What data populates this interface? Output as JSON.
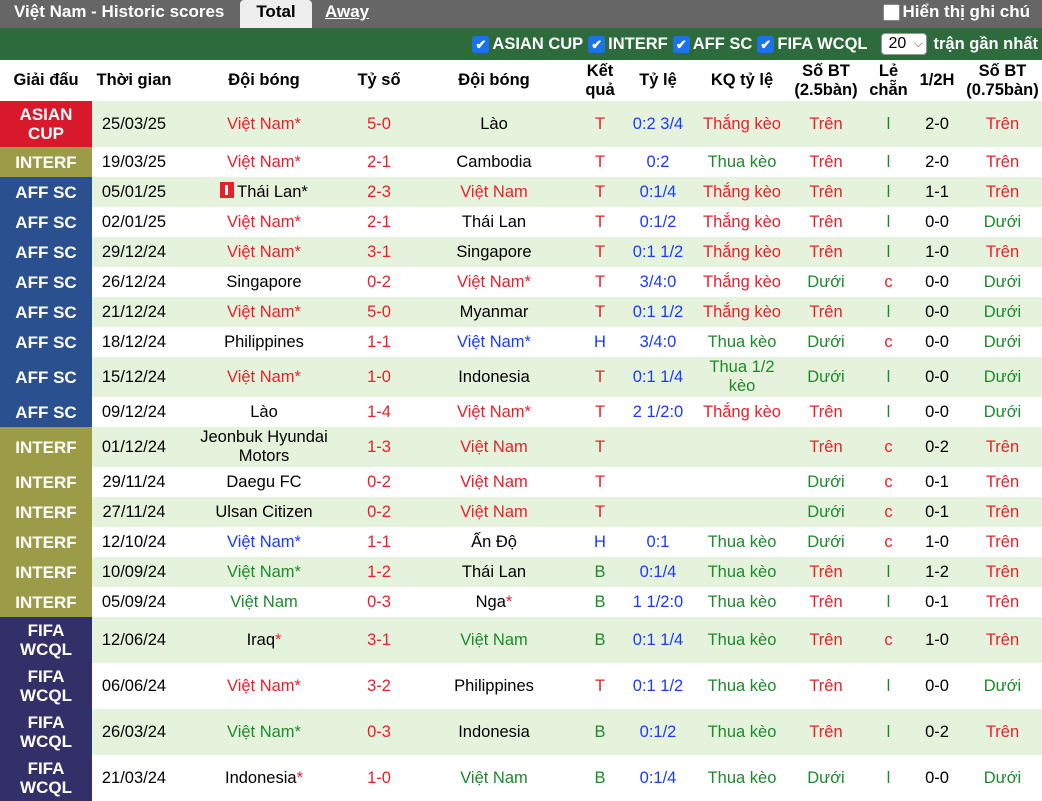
{
  "header": {
    "title": "Việt Nam - Historic scores",
    "tab_total": "Total",
    "tab_away": "Away",
    "show_label": "Hiển thị ghi chú"
  },
  "filters": {
    "items": [
      "ASIAN CUP",
      "INTERF",
      "AFF SC",
      "FIFA WCQL"
    ],
    "count_value": "20",
    "count_suffix": "trận gần nhất"
  },
  "colors": {
    "ASIAN CUP": "#d7192b",
    "INTERF": "#9c9c48",
    "AFF SC": "#2a5090",
    "FIFA WCQL": "#322f69"
  },
  "table": {
    "headers": [
      "Giải đấu",
      "Thời gian",
      "Đội bóng",
      "Tỷ số",
      "Đội bóng",
      "Kết quả",
      "Tỷ lệ",
      "KQ tỷ lệ",
      "Số BT (2.5bàn)",
      "Lẻ chẵn",
      "1/2H",
      "Số BT (0.75bàn)"
    ],
    "rows": [
      {
        "comp": "ASIAN CUP",
        "date": "25/03/25",
        "home": "Việt Nam*",
        "hc": "red",
        "score": "5-0",
        "away": "Lào",
        "ac": "black",
        "res": "T",
        "hdp": "0:2 3/4",
        "hr": "Thắng kèo",
        "hrc": "red",
        "ou": "Trên",
        "ouc": "red",
        "oe": "l",
        "oec": "green",
        "ht": "2-0",
        "ou2": "Trên",
        "ou2c": "red"
      },
      {
        "comp": "INTERF",
        "date": "19/03/25",
        "home": "Việt Nam*",
        "hc": "red",
        "score": "2-1",
        "away": "Cambodia",
        "ac": "black",
        "res": "T",
        "hdp": "0:2",
        "hr": "Thua kèo",
        "hrc": "green",
        "ou": "Trên",
        "ouc": "red",
        "oe": "l",
        "oec": "green",
        "ht": "2-0",
        "ou2": "Trên",
        "ou2c": "red"
      },
      {
        "comp": "AFF SC",
        "date": "05/01/25",
        "home": "Thái Lan*",
        "hc": "black",
        "flag": true,
        "score": "2-3",
        "away": "Việt Nam",
        "ac": "red",
        "res": "T",
        "hdp": "0:1/4",
        "hr": "Thắng kèo",
        "hrc": "red",
        "ou": "Trên",
        "ouc": "red",
        "oe": "l",
        "oec": "green",
        "ht": "1-1",
        "ou2": "Trên",
        "ou2c": "red"
      },
      {
        "comp": "AFF SC",
        "date": "02/01/25",
        "home": "Việt Nam*",
        "hc": "red",
        "score": "2-1",
        "away": "Thái Lan",
        "ac": "black",
        "res": "T",
        "hdp": "0:1/2",
        "hr": "Thắng kèo",
        "hrc": "red",
        "ou": "Trên",
        "ouc": "red",
        "oe": "l",
        "oec": "green",
        "ht": "0-0",
        "ou2": "Dưới",
        "ou2c": "green"
      },
      {
        "comp": "AFF SC",
        "date": "29/12/24",
        "home": "Việt Nam*",
        "hc": "red",
        "score": "3-1",
        "away": "Singapore",
        "ac": "black",
        "res": "T",
        "hdp": "0:1 1/2",
        "hr": "Thắng kèo",
        "hrc": "red",
        "ou": "Trên",
        "ouc": "red",
        "oe": "l",
        "oec": "green",
        "ht": "1-0",
        "ou2": "Trên",
        "ou2c": "red"
      },
      {
        "comp": "AFF SC",
        "date": "26/12/24",
        "home": "Singapore",
        "hc": "black",
        "score": "0-2",
        "away": "Việt Nam*",
        "ac": "red",
        "res": "T",
        "hdp": "3/4:0",
        "hr": "Thắng kèo",
        "hrc": "red",
        "ou": "Dưới",
        "ouc": "green",
        "oe": "c",
        "oec": "red",
        "ht": "0-0",
        "ou2": "Dưới",
        "ou2c": "green"
      },
      {
        "comp": "AFF SC",
        "date": "21/12/24",
        "home": "Việt Nam*",
        "hc": "red",
        "score": "5-0",
        "away": "Myanmar",
        "ac": "black",
        "res": "T",
        "hdp": "0:1 1/2",
        "hr": "Thắng kèo",
        "hrc": "red",
        "ou": "Trên",
        "ouc": "red",
        "oe": "l",
        "oec": "green",
        "ht": "0-0",
        "ou2": "Dưới",
        "ou2c": "green"
      },
      {
        "comp": "AFF SC",
        "date": "18/12/24",
        "home": "Philippines",
        "hc": "black",
        "score": "1-1",
        "away": "Việt Nam*",
        "ac": "blue",
        "res": "H",
        "hdp": "3/4:0",
        "hr": "Thua kèo",
        "hrc": "green",
        "ou": "Dưới",
        "ouc": "green",
        "oe": "c",
        "oec": "red",
        "ht": "0-0",
        "ou2": "Dưới",
        "ou2c": "green"
      },
      {
        "comp": "AFF SC",
        "date": "15/12/24",
        "home": "Việt Nam*",
        "hc": "red",
        "score": "1-0",
        "away": "Indonesia",
        "ac": "black",
        "res": "T",
        "hdp": "0:1 1/4",
        "hr": "Thua 1/2 kèo",
        "hrc": "green",
        "ou": "Dưới",
        "ouc": "green",
        "oe": "l",
        "oec": "green",
        "ht": "0-0",
        "ou2": "Dưới",
        "ou2c": "green"
      },
      {
        "comp": "AFF SC",
        "date": "09/12/24",
        "home": "Lào",
        "hc": "black",
        "score": "1-4",
        "away": "Việt Nam*",
        "ac": "red",
        "res": "T",
        "hdp": "2 1/2:0",
        "hr": "Thắng kèo",
        "hrc": "red",
        "ou": "Trên",
        "ouc": "red",
        "oe": "l",
        "oec": "green",
        "ht": "0-0",
        "ou2": "Dưới",
        "ou2c": "green"
      },
      {
        "comp": "INTERF",
        "date": "01/12/24",
        "home": "Jeonbuk Hyundai Motors",
        "hc": "black",
        "score": "1-3",
        "away": "Việt Nam",
        "ac": "red",
        "res": "T",
        "hdp": "",
        "hr": "",
        "hrc": "black",
        "ou": "Trên",
        "ouc": "red",
        "oe": "c",
        "oec": "red",
        "ht": "0-2",
        "ou2": "Trên",
        "ou2c": "red"
      },
      {
        "comp": "INTERF",
        "date": "29/11/24",
        "home": "Daegu FC",
        "hc": "black",
        "score": "0-2",
        "away": "Việt Nam",
        "ac": "red",
        "res": "T",
        "hdp": "",
        "hr": "",
        "hrc": "black",
        "ou": "Dưới",
        "ouc": "green",
        "oe": "c",
        "oec": "red",
        "ht": "0-1",
        "ou2": "Trên",
        "ou2c": "red"
      },
      {
        "comp": "INTERF",
        "date": "27/11/24",
        "home": "Ulsan Citizen",
        "hc": "black",
        "score": "0-2",
        "away": "Việt Nam",
        "ac": "red",
        "res": "T",
        "hdp": "",
        "hr": "",
        "hrc": "black",
        "ou": "Dưới",
        "ouc": "green",
        "oe": "c",
        "oec": "red",
        "ht": "0-1",
        "ou2": "Trên",
        "ou2c": "red"
      },
      {
        "comp": "INTERF",
        "date": "12/10/24",
        "home": "Việt Nam*",
        "hc": "blue",
        "score": "1-1",
        "away": "Ấn Độ",
        "ac": "black",
        "res": "H",
        "hdp": "0:1",
        "hr": "Thua kèo",
        "hrc": "green",
        "ou": "Dưới",
        "ouc": "green",
        "oe": "c",
        "oec": "red",
        "ht": "1-0",
        "ou2": "Trên",
        "ou2c": "red"
      },
      {
        "comp": "INTERF",
        "date": "10/09/24",
        "home": "Việt Nam*",
        "hc": "green",
        "score": "1-2",
        "away": "Thái Lan",
        "ac": "black",
        "res": "B",
        "hdp": "0:1/4",
        "hr": "Thua kèo",
        "hrc": "green",
        "ou": "Trên",
        "ouc": "red",
        "oe": "l",
        "oec": "green",
        "ht": "1-2",
        "ou2": "Trên",
        "ou2c": "red"
      },
      {
        "comp": "INTERF",
        "date": "05/09/24",
        "home": "Việt Nam",
        "hc": "green",
        "score": "0-3",
        "away": "Nga*",
        "ac": "black",
        "astar": true,
        "res": "B",
        "hdp": "1 1/2:0",
        "hr": "Thua kèo",
        "hrc": "green",
        "ou": "Trên",
        "ouc": "red",
        "oe": "l",
        "oec": "green",
        "ht": "0-1",
        "ou2": "Trên",
        "ou2c": "red"
      },
      {
        "comp": "FIFA WCQL",
        "date": "12/06/24",
        "home": "Iraq*",
        "hc": "black",
        "hstar": true,
        "score": "3-1",
        "away": "Việt Nam",
        "ac": "green",
        "res": "B",
        "hdp": "0:1 1/4",
        "hr": "Thua kèo",
        "hrc": "green",
        "ou": "Trên",
        "ouc": "red",
        "oe": "c",
        "oec": "red",
        "ht": "1-0",
        "ou2": "Trên",
        "ou2c": "red"
      },
      {
        "comp": "FIFA WCQL",
        "date": "06/06/24",
        "home": "Việt Nam*",
        "hc": "red",
        "score": "3-2",
        "away": "Philippines",
        "ac": "black",
        "res": "T",
        "hdp": "0:1 1/2",
        "hr": "Thua kèo",
        "hrc": "green",
        "ou": "Trên",
        "ouc": "red",
        "oe": "l",
        "oec": "green",
        "ht": "0-0",
        "ou2": "Dưới",
        "ou2c": "green"
      },
      {
        "comp": "FIFA WCQL",
        "date": "26/03/24",
        "home": "Việt Nam*",
        "hc": "green",
        "score": "0-3",
        "away": "Indonesia",
        "ac": "black",
        "res": "B",
        "hdp": "0:1/2",
        "hr": "Thua kèo",
        "hrc": "green",
        "ou": "Trên",
        "ouc": "red",
        "oe": "l",
        "oec": "green",
        "ht": "0-2",
        "ou2": "Trên",
        "ou2c": "red"
      },
      {
        "comp": "FIFA WCQL",
        "date": "21/03/24",
        "home": "Indonesia*",
        "hc": "black",
        "hstar": true,
        "score": "1-0",
        "away": "Việt Nam",
        "ac": "green",
        "res": "B",
        "hdp": "0:1/4",
        "hr": "Thua kèo",
        "hrc": "green",
        "ou": "Dưới",
        "ouc": "green",
        "oe": "l",
        "oec": "green",
        "ht": "0-0",
        "ou2": "Dưới",
        "ou2c": "green"
      }
    ]
  }
}
